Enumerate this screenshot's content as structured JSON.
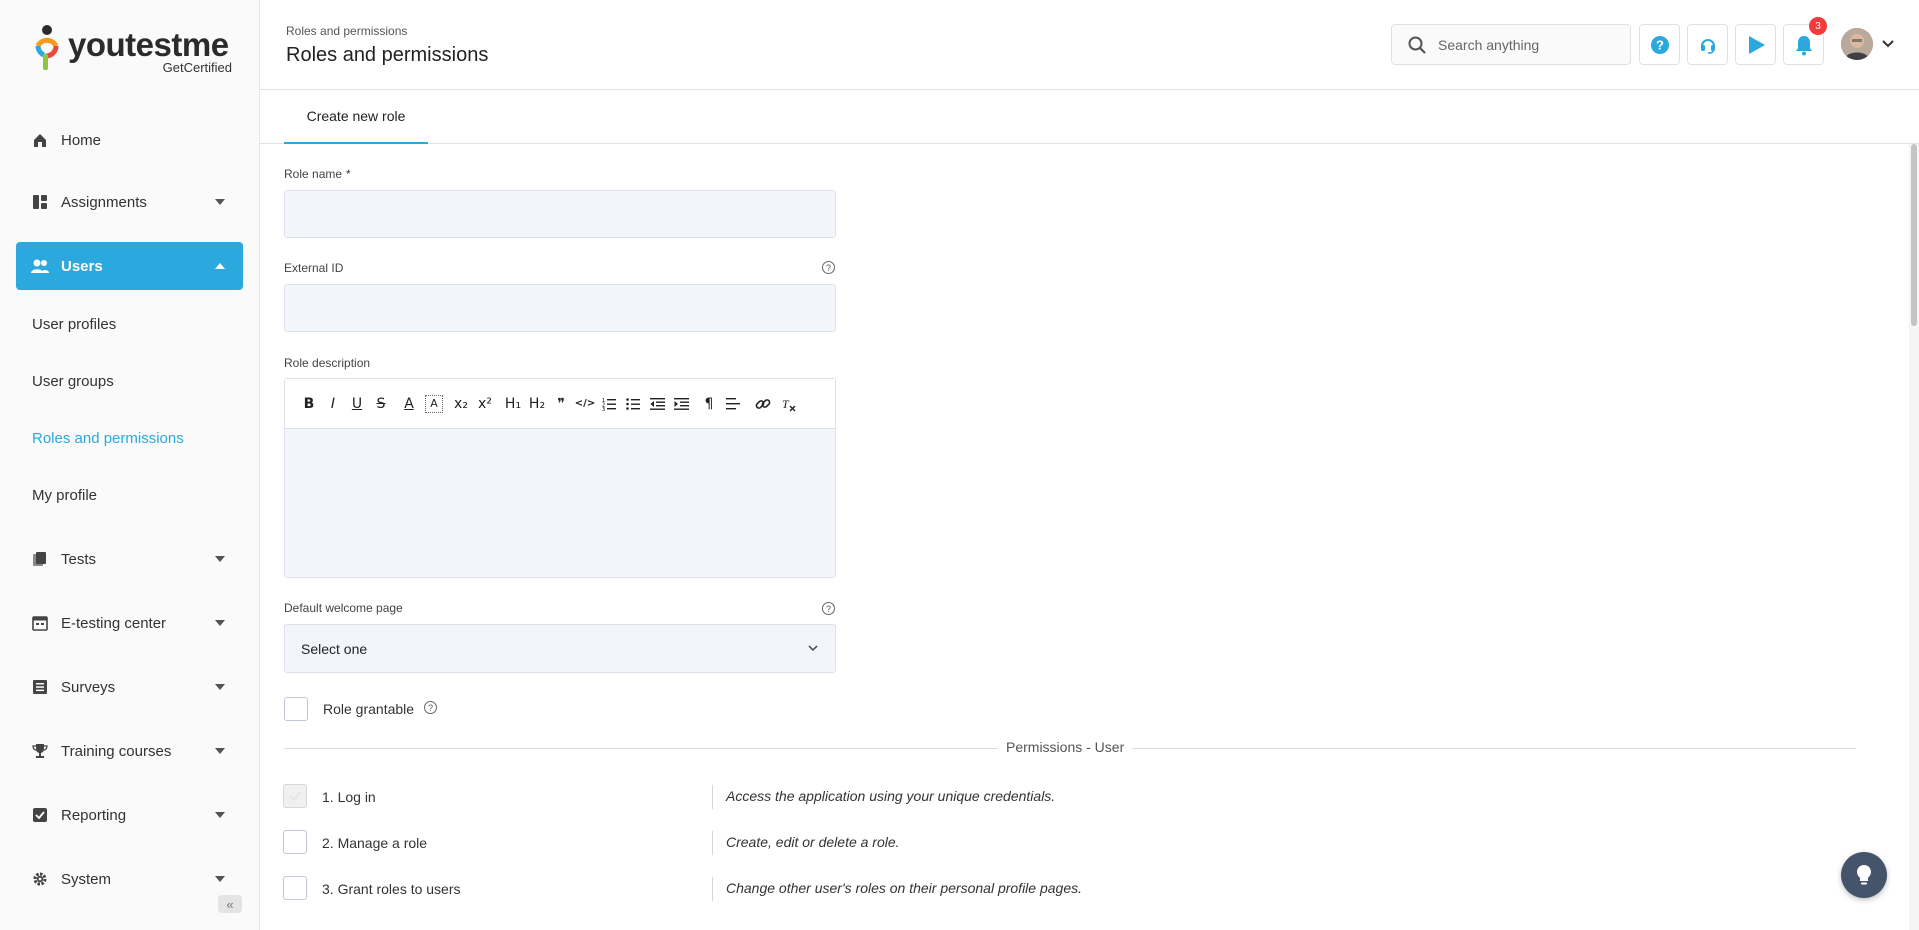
{
  "brand": {
    "name_you": "you",
    "name_test": "test",
    "name_me": "me",
    "tagline": "GetCertified",
    "accent": "#2ba8de"
  },
  "sidebar": {
    "items": [
      {
        "label": "Home",
        "icon": "home-icon"
      },
      {
        "label": "Assignments",
        "icon": "assignments-icon"
      },
      {
        "label": "Users",
        "icon": "users-icon",
        "active": true
      },
      {
        "label": "Tests",
        "icon": "tests-icon"
      },
      {
        "label": "E-testing center",
        "icon": "calendar-icon"
      },
      {
        "label": "Surveys",
        "icon": "surveys-icon"
      },
      {
        "label": "Training courses",
        "icon": "trophy-icon"
      },
      {
        "label": "Reporting",
        "icon": "reporting-icon"
      },
      {
        "label": "System",
        "icon": "gear-icon"
      }
    ],
    "users_sub": [
      "User profiles",
      "User groups",
      "Roles and permissions",
      "My profile"
    ]
  },
  "header": {
    "breadcrumb": "Roles and permissions",
    "title": "Roles and permissions",
    "search_placeholder": "Search anything",
    "notification_count": "3"
  },
  "tabs": [
    "Create new role"
  ],
  "form": {
    "role_name_label": "Role name",
    "required_mark": "*",
    "external_id_label": "External ID",
    "role_description_label": "Role description",
    "default_welcome_label": "Default welcome page",
    "default_welcome_value": "Select one",
    "role_grantable_label": "Role grantable",
    "help_glyph": "?"
  },
  "editor_toolbar": [
    "B",
    "I",
    "U",
    "S",
    "A",
    "A",
    "x₂",
    "x²",
    "H₁",
    "H₂",
    "❞",
    "</>",
    "ol",
    "ul",
    "outdent",
    "indent",
    "¶",
    "align",
    "link",
    "clear"
  ],
  "permissions": {
    "section_title": "Permissions - User",
    "items": [
      {
        "label": "1. Log in",
        "description": "Access the application using your unique credentials."
      },
      {
        "label": "2. Manage a role",
        "description": "Create, edit or delete a role."
      },
      {
        "label": "3. Grant roles to users",
        "description": "Change other user's roles on their personal profile pages."
      }
    ]
  }
}
